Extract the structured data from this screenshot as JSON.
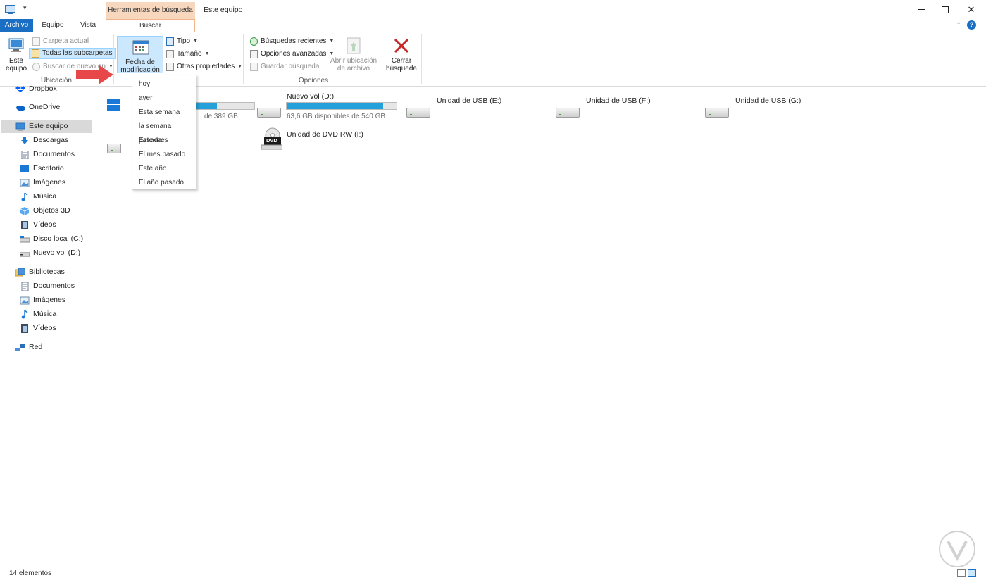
{
  "titlebar": {
    "context_header": "Herramientas de búsqueda",
    "window_title": "Este equipo",
    "minimize_icon": "minimize-icon",
    "maximize_icon": "maximize-icon",
    "close_glyph": "✕"
  },
  "tabs": {
    "file": "Archivo",
    "computer": "Equipo",
    "view": "Vista",
    "search": "Buscar",
    "help_glyph": "?"
  },
  "ribbon": {
    "location": {
      "group_label": "Ubicación",
      "this_pc": [
        "Este",
        "equipo"
      ],
      "current_folder": "Carpeta actual",
      "all_subfolders": "Todas las subcarpetas",
      "search_again": "Buscar de nuevo en"
    },
    "refine": {
      "date_modified": [
        "Fecha de",
        "modificación"
      ],
      "type": "Tipo",
      "size": "Tamaño",
      "other_properties": "Otras propiedades"
    },
    "options": {
      "group_label": "Opciones",
      "recent_searches": "Búsquedas recientes",
      "advanced_options": "Opciones avanzadas",
      "save_search": "Guardar búsqueda",
      "open_file_location": [
        "Abrir ubicación",
        "de archivo"
      ]
    },
    "close_search": [
      "Cerrar",
      "búsqueda"
    ]
  },
  "date_menu": {
    "items": [
      "hoy",
      "ayer",
      "Esta semana",
      "la semana pasada",
      "Este mes",
      "El mes pasado",
      "Este año",
      "El año pasado"
    ]
  },
  "sidebar": {
    "dropbox": "Dropbox",
    "onedrive": "OneDrive",
    "this_pc": "Este equipo",
    "this_pc_children": [
      "Descargas",
      "Documentos",
      "Escritorio",
      "Imágenes",
      "Música",
      "Objetos 3D",
      "Vídeos",
      "Disco local (C:)",
      "Nuevo vol (D:)"
    ],
    "libraries": "Bibliotecas",
    "libraries_children": [
      "Documentos",
      "Imágenes",
      "Música",
      "Vídeos"
    ],
    "network": "Red"
  },
  "drives": {
    "c_free": "de 389 GB",
    "c_fill": 0.62,
    "d_name": "Nuevo vol (D:)",
    "d_free": "63,6 GB disponibles de 540 GB",
    "d_fill": 0.88,
    "usb_e": "Unidad de USB (E:)",
    "usb_f": "Unidad de USB (F:)",
    "usb_g": "Unidad de USB (G:)",
    "dvd": "Unidad de DVD RW (I:)",
    "dvd_badge": "DVD"
  },
  "status": {
    "count": "14 elementos"
  },
  "colors": {
    "accent": "#1a6fc4",
    "context_tab": "#f7d8bf",
    "drive_fill": "#26a0da",
    "selection": "#cce8ff",
    "arrow": "#e8474a"
  }
}
